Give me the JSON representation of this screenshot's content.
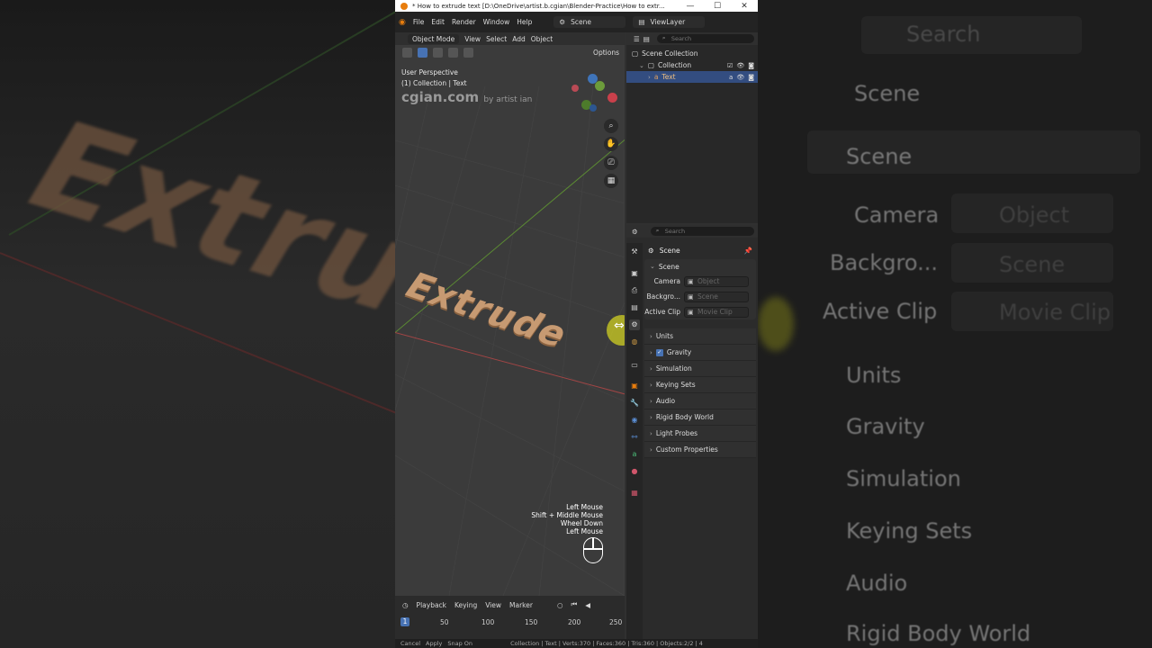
{
  "window": {
    "title": "* How to extrude text [D:\\OneDrive\\artist.b.cgian\\Blender-Practice\\How to extr...",
    "controls": [
      "—",
      "☐",
      "✕"
    ]
  },
  "menu": [
    "File",
    "Edit",
    "Render",
    "Window",
    "Help"
  ],
  "scene_selector": "Scene",
  "viewlayer_selector": "ViewLayer",
  "viewport": {
    "mode": "Object Mode",
    "menus": [
      "View",
      "Select",
      "Add",
      "Object"
    ],
    "options_label": "Options",
    "info_line1": "User Perspective",
    "info_line2": "(1) Collection | Text",
    "watermark": "cgian.com",
    "watermark_by": "by artist ian",
    "object_text": "Extrude",
    "key_hints": [
      "Left Mouse",
      "Shift + Middle Mouse",
      "Wheel Down",
      "Left Mouse"
    ]
  },
  "timeline": {
    "menus": [
      "Playback",
      "Keying",
      "View",
      "Marker"
    ],
    "current_frame": "1",
    "ticks": [
      "50",
      "100",
      "150",
      "200",
      "250"
    ]
  },
  "statusbar": {
    "items": [
      "Cancel",
      "Apply",
      "Snap On"
    ],
    "stats": "Collection | Text | Verts:370 | Faces:360 | Tris:360 | Objects:2/2 | 4"
  },
  "outliner": {
    "search_placeholder": "Search",
    "scene_collection": "Scene Collection",
    "collection": "Collection",
    "text_object": "Text"
  },
  "properties": {
    "search_placeholder": "Search",
    "header_title": "Scene",
    "section_title": "Scene",
    "fields": [
      {
        "label": "Camera",
        "value": "Object"
      },
      {
        "label": "Backgro...",
        "value": "Scene"
      },
      {
        "label": "Active Clip",
        "value": "Movie Clip"
      }
    ],
    "subpanels": [
      "Units",
      "Gravity",
      "Simulation",
      "Keying Sets",
      "Audio",
      "Rigid Body World",
      "Light Probes",
      "Custom Properties"
    ],
    "gravity_checked": true
  },
  "blurred_right": {
    "rows": [
      "Scene",
      "Scene",
      "Camera",
      "Object",
      "Backgro...",
      "Scene",
      "Active Clip",
      "Movie Clip",
      "Units",
      "Gravity",
      "Simulation",
      "Keying Sets",
      "Audio",
      "Rigid Body World",
      "Search"
    ]
  },
  "blurred_left": {
    "text": "Extrude"
  },
  "colors": {
    "accent": "#4772b3",
    "text_object": "#c79a72",
    "x_axis": "#a04545",
    "y_axis": "#5b8a33"
  }
}
